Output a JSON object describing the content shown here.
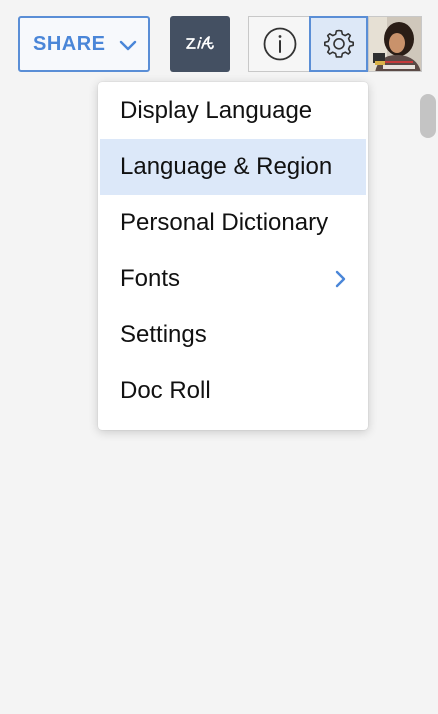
{
  "toolbar": {
    "share_label": "SHARE",
    "share_chevron_icon": "chevron-down-icon",
    "sign_icon": "signature-icon",
    "info_icon": "info-icon",
    "settings_icon": "gear-icon",
    "avatar": "user-avatar"
  },
  "colors": {
    "accent": "#4a86d8",
    "dark_button": "#445062",
    "active_item_bg": "#dce8f9",
    "page_bg": "#f4f4f4"
  },
  "settings_menu": {
    "items": [
      {
        "label": "Display Language",
        "active": false,
        "has_submenu": false
      },
      {
        "label": "Language & Region",
        "active": true,
        "has_submenu": false
      },
      {
        "label": "Personal Dictionary",
        "active": false,
        "has_submenu": false
      },
      {
        "label": "Fonts",
        "active": false,
        "has_submenu": true
      },
      {
        "label": "Settings",
        "active": false,
        "has_submenu": false
      },
      {
        "label": "Doc Roll",
        "active": false,
        "has_submenu": false
      }
    ]
  }
}
